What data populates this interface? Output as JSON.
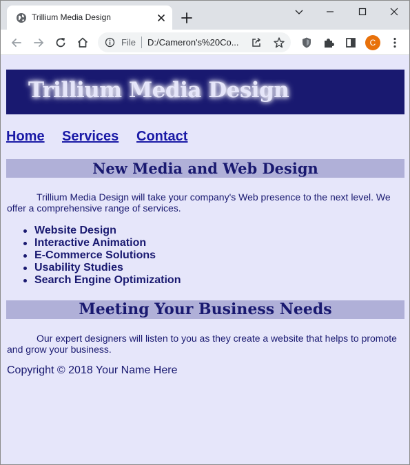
{
  "browser": {
    "tab_title": "Trillium Media Design",
    "address_scheme": "File",
    "address_url": "D:/Cameron's%20Co...",
    "profile_initial": "C"
  },
  "site": {
    "title": "Trillium Media Design",
    "nav": [
      "Home",
      "Services",
      "Contact"
    ],
    "section1_heading": "New Media and Web Design",
    "section1_paragraph": "Trillium Media Design will take your company's Web presence to the next level. We offer a comprehensive range of services.",
    "services": [
      "Website Design",
      "Interactive Animation",
      "E-Commerce Solutions",
      "Usability Studies",
      "Search Engine Optimization"
    ],
    "section2_heading": "Meeting Your Business Needs",
    "section2_paragraph": "Our expert designers will listen to you as they create a website that helps to promote and grow your business.",
    "copyright": "Copyright © 2018 Your Name Here"
  },
  "colors": {
    "page_background": "#e6e6fa",
    "header_background": "#191970",
    "section_heading_background": "#b0b0d8",
    "text": "#191970",
    "link": "#1a1aa6",
    "avatar": "#e8710a"
  },
  "icons": {
    "tab": [
      "globe-icon",
      "close-icon",
      "plus-icon"
    ],
    "window": [
      "chevron-down-icon",
      "minimize-icon",
      "maximize-icon",
      "close-window-icon"
    ],
    "toolbar": [
      "back-icon",
      "forward-icon",
      "reload-icon",
      "home-icon",
      "info-icon",
      "share-icon",
      "star-icon",
      "shield-icon",
      "extensions-icon",
      "sidepanel-icon",
      "kebab-menu-icon"
    ]
  }
}
